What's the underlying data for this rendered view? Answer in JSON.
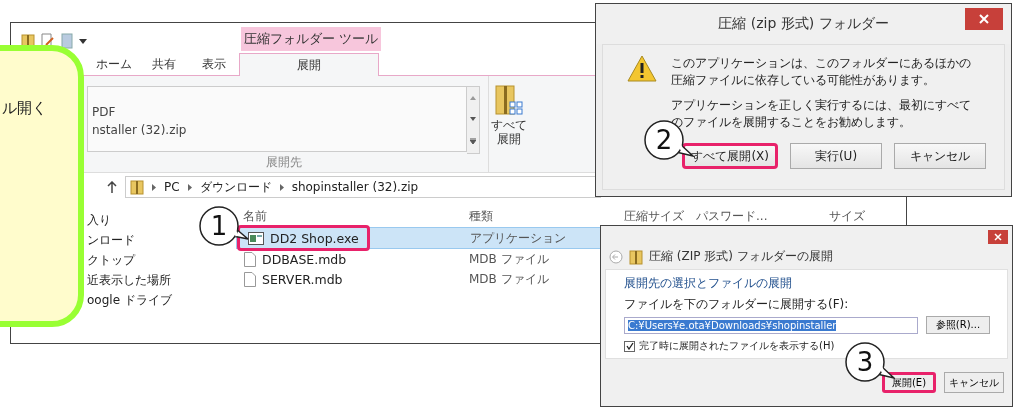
{
  "explorer": {
    "context_tab": "圧縮フォルダー ツール",
    "tabs": [
      {
        "label": "ホーム",
        "selected": false
      },
      {
        "label": "共有",
        "selected": false
      },
      {
        "label": "表示",
        "selected": false
      },
      {
        "label": "展開",
        "selected": true
      }
    ],
    "ribbon": {
      "list_items": [
        "PDF",
        "nstaller (32).zip"
      ],
      "extract_all_button": "すべて展開",
      "group_label": "展開先"
    },
    "address": [
      "PC",
      "ダウンロード",
      "shopinstaller (32).zip"
    ],
    "nav_items": [
      "入り",
      "ンロード",
      "クトップ",
      "近表示した場所",
      "oogle ドライブ"
    ],
    "columns": [
      "名前",
      "種類",
      "圧縮サイズ",
      "パスワード...",
      "サイズ"
    ],
    "files": [
      {
        "name": "DD2 Shop.exe",
        "type": "アプリケーション",
        "kind": "app",
        "selected": true,
        "highlighted": true
      },
      {
        "name": "DDBASE.mdb",
        "type": "MDB ファイル",
        "kind": "doc",
        "selected": false,
        "highlighted": false
      },
      {
        "name": "SERVER.mdb",
        "type": "MDB ファイル",
        "kind": "doc",
        "selected": false,
        "highlighted": false
      }
    ],
    "marker": "1"
  },
  "note": {
    "text": "ル開く"
  },
  "dialog": {
    "title": "圧縮 (zip 形式) フォルダー",
    "messages": [
      "このアプリケーションは、このフォルダーにあるほかの圧縮ファイルに依存している可能性があります。",
      "アプリケーションを正しく実行するには、最初にすべてのファイルを展開することをお勧めします。"
    ],
    "buttons": [
      {
        "label": "すべて展開(X)",
        "highlighted": true
      },
      {
        "label": "実行(U)",
        "highlighted": false
      },
      {
        "label": "キャンセル",
        "highlighted": false
      }
    ],
    "marker": "2"
  },
  "extract_dialog": {
    "title": "圧縮 (ZIP 形式) フォルダーの展開",
    "heading": "展開先の選択とファイルの展開",
    "field_label": "ファイルを下のフォルダーに展開する(F):",
    "path": "C:¥Users¥e.ota¥Downloads¥shopinstaller",
    "browse_button": "参照(R)...",
    "checkbox": {
      "label": "完了時に展開されたファイルを表示する(H)",
      "checked": true
    },
    "buttons": [
      {
        "label": "展開(E)",
        "highlighted": true
      },
      {
        "label": "キャンセル",
        "highlighted": false
      }
    ],
    "marker": "3"
  }
}
